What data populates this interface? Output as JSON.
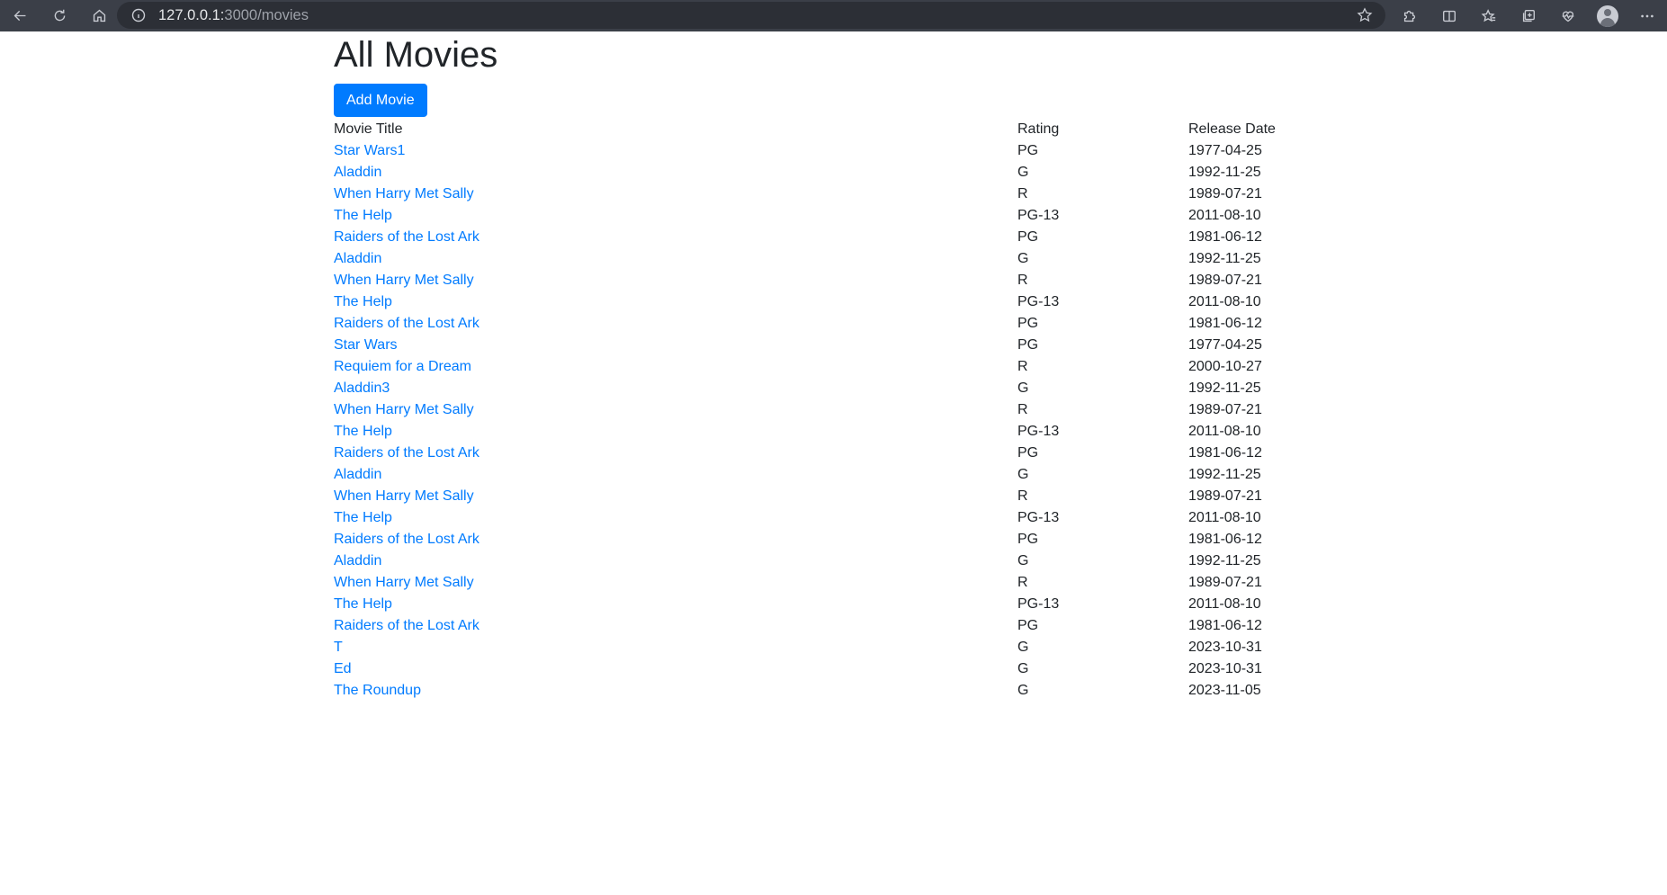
{
  "browser": {
    "url_host": "127.0.0.1:",
    "url_path": "3000/movies"
  },
  "page": {
    "title": "All Movies",
    "add_button_label": "Add Movie"
  },
  "table": {
    "headers": [
      "Movie Title",
      "Rating",
      "Release Date"
    ],
    "rows": [
      {
        "title": "Star Wars1",
        "rating": "PG",
        "release_date": "1977-04-25"
      },
      {
        "title": "Aladdin",
        "rating": "G",
        "release_date": "1992-11-25"
      },
      {
        "title": "When Harry Met Sally",
        "rating": "R",
        "release_date": "1989-07-21"
      },
      {
        "title": "The Help",
        "rating": "PG-13",
        "release_date": "2011-08-10"
      },
      {
        "title": "Raiders of the Lost Ark",
        "rating": "PG",
        "release_date": "1981-06-12"
      },
      {
        "title": "Aladdin",
        "rating": "G",
        "release_date": "1992-11-25"
      },
      {
        "title": "When Harry Met Sally",
        "rating": "R",
        "release_date": "1989-07-21"
      },
      {
        "title": "The Help",
        "rating": "PG-13",
        "release_date": "2011-08-10"
      },
      {
        "title": "Raiders of the Lost Ark",
        "rating": "PG",
        "release_date": "1981-06-12"
      },
      {
        "title": "Star Wars",
        "rating": "PG",
        "release_date": "1977-04-25"
      },
      {
        "title": "Requiem for a Dream",
        "rating": "R",
        "release_date": "2000-10-27"
      },
      {
        "title": "Aladdin3",
        "rating": "G",
        "release_date": "1992-11-25"
      },
      {
        "title": "When Harry Met Sally",
        "rating": "R",
        "release_date": "1989-07-21"
      },
      {
        "title": "The Help",
        "rating": "PG-13",
        "release_date": "2011-08-10"
      },
      {
        "title": "Raiders of the Lost Ark",
        "rating": "PG",
        "release_date": "1981-06-12"
      },
      {
        "title": "Aladdin",
        "rating": "G",
        "release_date": "1992-11-25"
      },
      {
        "title": "When Harry Met Sally",
        "rating": "R",
        "release_date": "1989-07-21"
      },
      {
        "title": "The Help",
        "rating": "PG-13",
        "release_date": "2011-08-10"
      },
      {
        "title": "Raiders of the Lost Ark",
        "rating": "PG",
        "release_date": "1981-06-12"
      },
      {
        "title": "Aladdin",
        "rating": "G",
        "release_date": "1992-11-25"
      },
      {
        "title": "When Harry Met Sally",
        "rating": "R",
        "release_date": "1989-07-21"
      },
      {
        "title": "The Help",
        "rating": "PG-13",
        "release_date": "2011-08-10"
      },
      {
        "title": "Raiders of the Lost Ark",
        "rating": "PG",
        "release_date": "1981-06-12"
      },
      {
        "title": "T",
        "rating": "G",
        "release_date": "2023-10-31"
      },
      {
        "title": "Ed",
        "rating": "G",
        "release_date": "2023-10-31"
      },
      {
        "title": "The Roundup",
        "rating": "G",
        "release_date": "2023-11-05"
      }
    ]
  },
  "colors": {
    "link": "#007bff",
    "button": "#007bff",
    "text": "#212529",
    "browser_bar": "#3b3f48"
  },
  "icons": {
    "back": "back-arrow-icon",
    "refresh": "refresh-icon",
    "home": "home-icon",
    "info": "info-icon",
    "favorite": "star-icon",
    "extensions": "puzzle-icon",
    "split": "split-screen-icon",
    "favorites": "favorites-icon",
    "collections": "collections-icon",
    "performance": "heart-pulse-icon",
    "profile": "profile-avatar-icon",
    "more": "more-dots-icon"
  }
}
